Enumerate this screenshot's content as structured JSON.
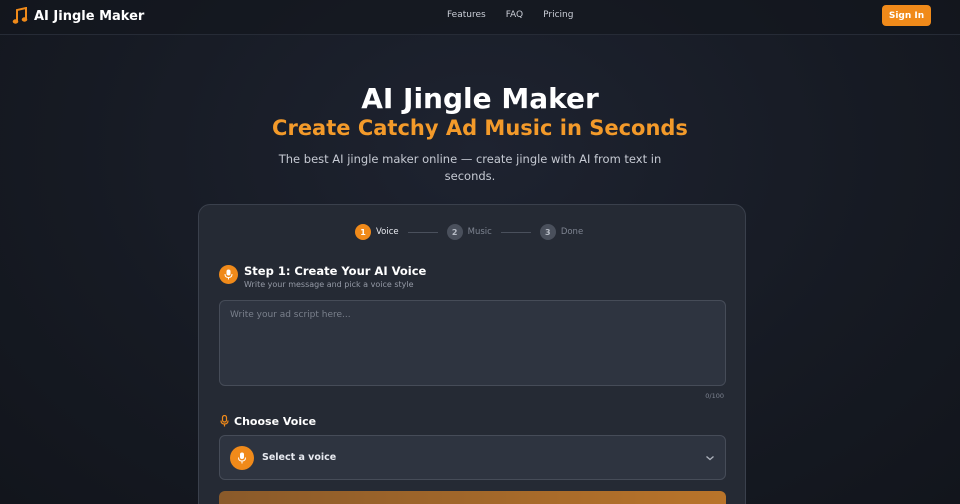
{
  "nav": {
    "brand": "AI Jingle Maker",
    "links": [
      "Features",
      "FAQ",
      "Pricing"
    ],
    "signin_label": "Sign In"
  },
  "hero": {
    "title": "AI Jingle Maker",
    "subtitle": "Create Catchy Ad Music in Seconds",
    "description": "The best AI jingle maker online — create jingle with AI from text in seconds."
  },
  "wizard": {
    "steps": [
      {
        "num": "1",
        "label": "Voice",
        "state": "active"
      },
      {
        "num": "2",
        "label": "Music",
        "state": "inactive"
      },
      {
        "num": "3",
        "label": "Done",
        "state": "inactive"
      }
    ],
    "section_title": "Step 1: Create Your AI Voice",
    "section_desc": "Write your message and pick a voice style",
    "script_placeholder": "Write your ad script here...",
    "char_count": "0/100",
    "voice_title": "Choose Voice",
    "voice_value": "Select a voice"
  },
  "icons": {
    "brand": "music-note-icon",
    "section": "microphone-icon",
    "voice": "microphone-icon",
    "select": "chevron-down-icon"
  },
  "colors": {
    "accent": "#f08a1a",
    "subtitle": "#f39a2a",
    "background": "#161a23",
    "card": "#252a34"
  }
}
